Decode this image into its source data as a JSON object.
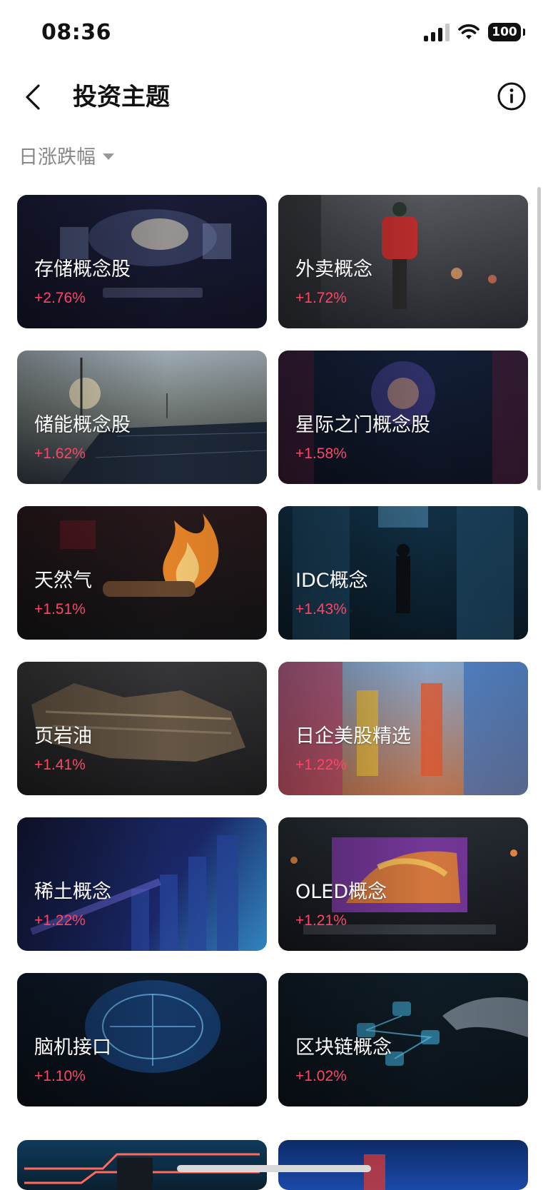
{
  "status_bar": {
    "time": "08:36",
    "battery": "100"
  },
  "nav": {
    "title": "投资主题"
  },
  "filter": {
    "label": "日涨跌幅"
  },
  "cards": [
    {
      "name": "存储概念股",
      "change": "+2.76%"
    },
    {
      "name": "外卖概念",
      "change": "+1.72%"
    },
    {
      "name": "储能概念股",
      "change": "+1.62%"
    },
    {
      "name": "星际之门概念股",
      "change": "+1.58%"
    },
    {
      "name": "天然气",
      "change": "+1.51%"
    },
    {
      "name": "IDC概念",
      "change": "+1.43%"
    },
    {
      "name": "页岩油",
      "change": "+1.41%"
    },
    {
      "name": "日企美股精选",
      "change": "+1.22%"
    },
    {
      "name": "稀土概念",
      "change": "+1.22%"
    },
    {
      "name": "OLED概念",
      "change": "+1.21%"
    },
    {
      "name": "脑机接口",
      "change": "+1.10%"
    },
    {
      "name": "区块链概念",
      "change": "+1.02%"
    }
  ],
  "colors": {
    "positive": "#ff4566",
    "filter_text": "#888888"
  },
  "icons": [
    "back-arrow-icon",
    "info-icon",
    "caret-down-icon",
    "signal-icon",
    "wifi-icon",
    "battery-icon"
  ]
}
